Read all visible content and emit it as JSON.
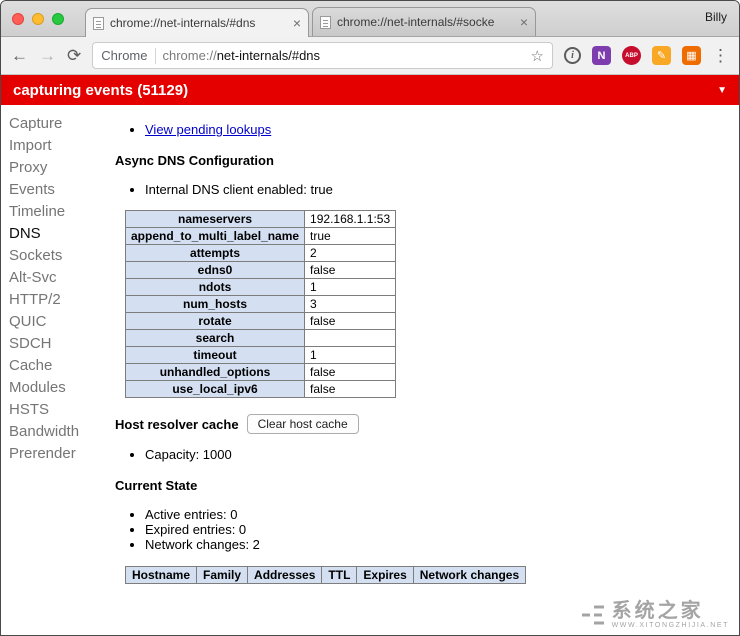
{
  "titlebar": {
    "profile": "Billy",
    "tabs": [
      {
        "title": "chrome://net-internals/#dns"
      },
      {
        "title": "chrome://net-internals/#socke"
      }
    ],
    "close_symbol": "×"
  },
  "toolbar": {
    "icons": {
      "back": "←",
      "forward": "→",
      "reload": "⟳",
      "star": "☆",
      "info": "i",
      "menu": "⋮"
    },
    "url_label": "Chrome",
    "url_scheme": "chrome://",
    "url_path": "net-internals/#dns",
    "extensions": [
      {
        "glyph": "N"
      },
      {
        "glyph": "ABP"
      },
      {
        "glyph": "✎"
      },
      {
        "glyph": "▦"
      }
    ]
  },
  "banner": {
    "text": "capturing events (51129)",
    "caret": "▼"
  },
  "sidebar": {
    "items": [
      "Capture",
      "Import",
      "Proxy",
      "Events",
      "Timeline",
      "DNS",
      "Sockets",
      "Alt-Svc",
      "HTTP/2",
      "QUIC",
      "SDCH",
      "Cache",
      "Modules",
      "HSTS",
      "Bandwidth",
      "Prerender"
    ],
    "active": "DNS"
  },
  "main": {
    "pending_link": "View pending lookups",
    "async_dns_heading": "Async DNS Configuration",
    "internal_dns_item": "Internal DNS client enabled: true",
    "config": {
      "rows": [
        {
          "key": "nameservers",
          "value": "192.168.1.1:53"
        },
        {
          "key": "append_to_multi_label_name",
          "value": "true"
        },
        {
          "key": "attempts",
          "value": "2"
        },
        {
          "key": "edns0",
          "value": "false"
        },
        {
          "key": "ndots",
          "value": "1"
        },
        {
          "key": "num_hosts",
          "value": "3"
        },
        {
          "key": "rotate",
          "value": "false"
        },
        {
          "key": "search",
          "value": ""
        },
        {
          "key": "timeout",
          "value": "1"
        },
        {
          "key": "unhandled_options",
          "value": "false"
        },
        {
          "key": "use_local_ipv6",
          "value": "false"
        }
      ]
    },
    "host_resolver_heading": "Host resolver cache",
    "clear_cache_button": "Clear host cache",
    "capacity_item": "Capacity: 1000",
    "current_state_heading": "Current State",
    "state_items": [
      "Active entries: 0",
      "Expired entries: 0",
      "Network changes: 2"
    ],
    "cache_table_headers": [
      "Hostname",
      "Family",
      "Addresses",
      "TTL",
      "Expires",
      "Network changes"
    ]
  },
  "watermark": {
    "title": "系统之家",
    "subtitle": "WWW.XITONGZHIJIA.NET"
  }
}
